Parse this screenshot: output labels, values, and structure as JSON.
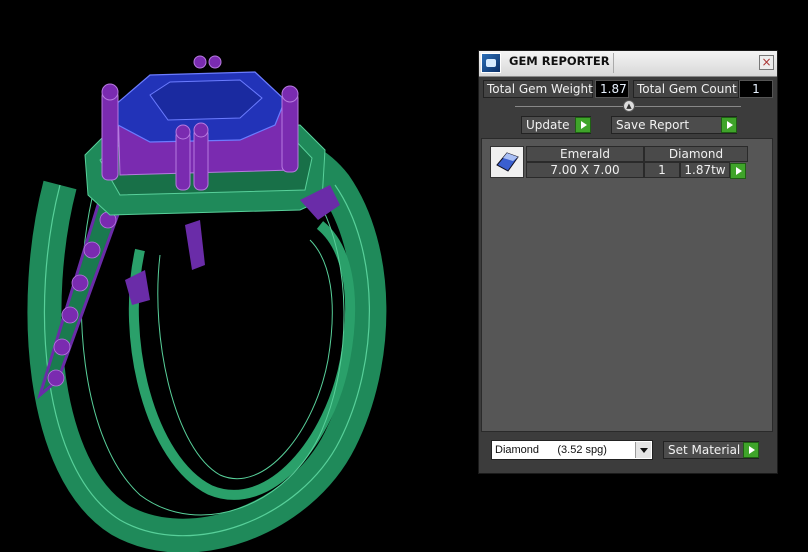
{
  "panel": {
    "title": "GEM REPORTER",
    "close_label": "×",
    "total_weight_label": "Total Gem Weight",
    "total_weight_value": "1.87",
    "total_count_label": "Total Gem Count",
    "total_count_value": "1",
    "update_label": "Update",
    "save_report_label": "Save Report",
    "rows": [
      {
        "shape": "Emerald",
        "size": "7.00 X 7.00",
        "material": "Diamond",
        "count": "1",
        "weight": "1.87tw"
      }
    ],
    "material_select": "Diamond      (3.52 spg)",
    "set_material_label": "Set Material"
  },
  "colors": {
    "ring_metal": "#1f8a5a",
    "prongs": "#7a2bb0",
    "center_stone": "#2233b8",
    "panel_bg": "#3c3c3c"
  }
}
